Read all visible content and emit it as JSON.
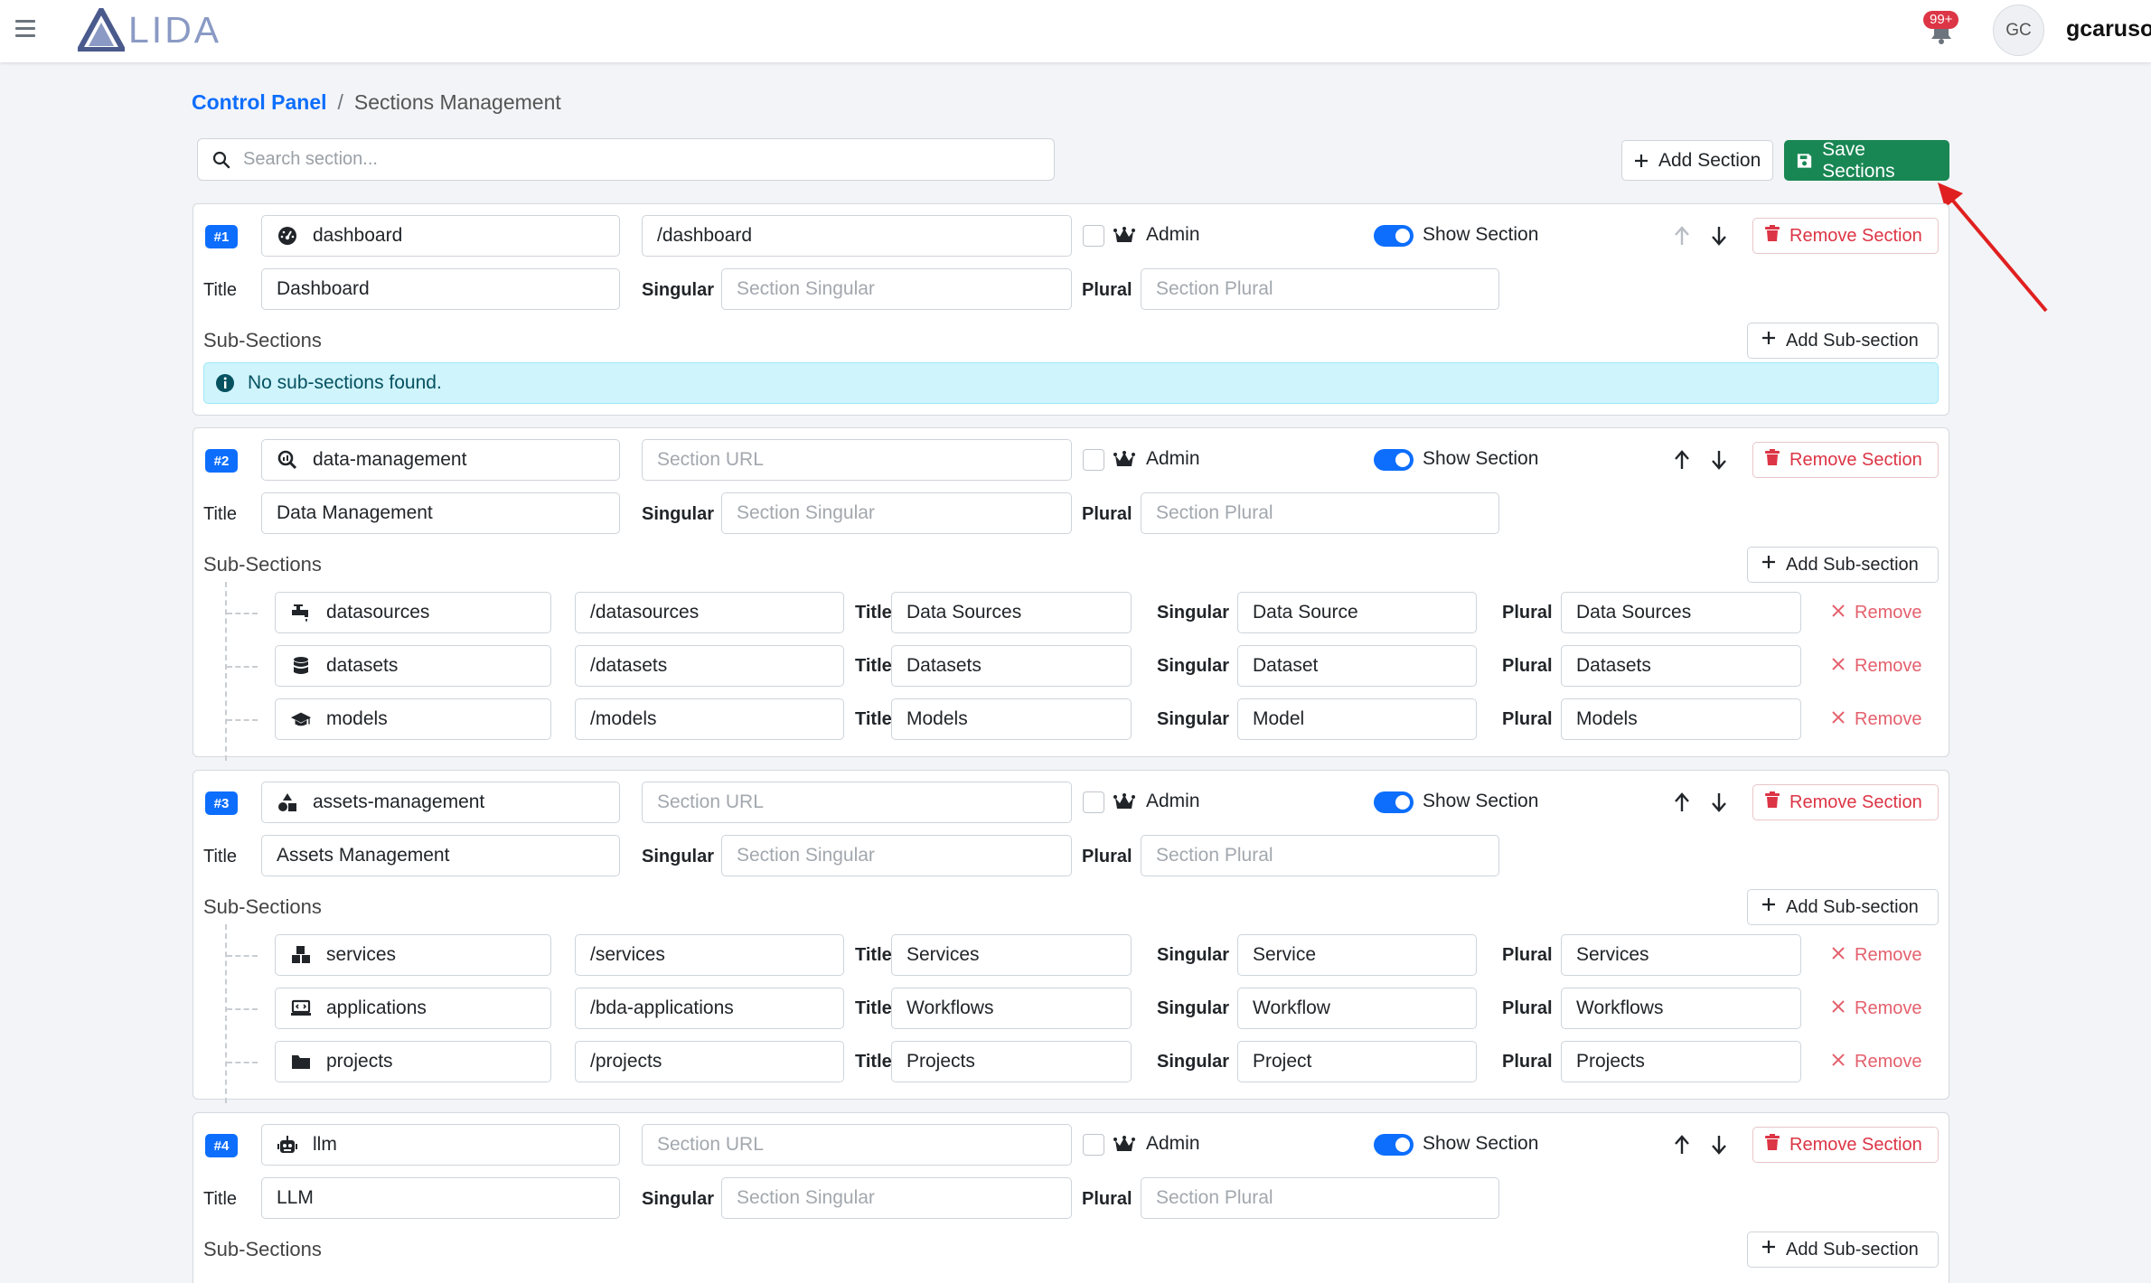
{
  "app": {
    "logo_text": "LIDA",
    "notification_count": "99+",
    "user_initials": "GC",
    "username": "gcaruso"
  },
  "breadcrumb": {
    "root": "Control Panel",
    "separator": "/",
    "current": "Sections Management"
  },
  "toolbar": {
    "search_placeholder": "Search section...",
    "add_section_label": "Add Section",
    "save_sections_label": "Save Sections"
  },
  "labels": {
    "admin": "Admin",
    "show_section": "Show Section",
    "remove_section": "Remove Section",
    "title": "Title",
    "singular": "Singular",
    "plural": "Plural",
    "sub_sections": "Sub-Sections",
    "add_sub_section": "Add Sub-section",
    "remove": "Remove",
    "no_sub_sections": "No sub-sections found.",
    "section_url_placeholder": "Section URL",
    "section_singular_placeholder": "Section Singular",
    "section_plural_placeholder": "Section Plural"
  },
  "sections": [
    {
      "badge": "#1",
      "icon": "dashboard-gauge-icon",
      "name": "dashboard",
      "url": "/dashboard",
      "title": "Dashboard",
      "singular": "",
      "plural": "",
      "admin": false,
      "show": true,
      "up_enabled": false,
      "subsections": []
    },
    {
      "badge": "#2",
      "icon": "magnifier-chart-icon",
      "name": "data-management",
      "url": "",
      "title": "Data Management",
      "singular": "",
      "plural": "",
      "admin": false,
      "show": true,
      "up_enabled": true,
      "subsections": [
        {
          "icon": "faucet-icon",
          "name": "datasources",
          "url": "/datasources",
          "title": "Data Sources",
          "singular": "Data Source",
          "plural": "Data Sources"
        },
        {
          "icon": "database-icon",
          "name": "datasets",
          "url": "/datasets",
          "title": "Datasets",
          "singular": "Dataset",
          "plural": "Datasets"
        },
        {
          "icon": "graduation-cap-icon",
          "name": "models",
          "url": "/models",
          "title": "Models",
          "singular": "Model",
          "plural": "Models"
        }
      ]
    },
    {
      "badge": "#3",
      "icon": "shapes-icon",
      "name": "assets-management",
      "url": "",
      "title": "Assets Management",
      "singular": "",
      "plural": "",
      "admin": false,
      "show": true,
      "up_enabled": true,
      "subsections": [
        {
          "icon": "cubes-icon",
          "name": "services",
          "url": "/services",
          "title": "Services",
          "singular": "Service",
          "plural": "Services"
        },
        {
          "icon": "laptop-code-icon",
          "name": "applications",
          "url": "/bda-applications",
          "title": "Workflows",
          "singular": "Workflow",
          "plural": "Workflows"
        },
        {
          "icon": "folder-icon",
          "name": "projects",
          "url": "/projects",
          "title": "Projects",
          "singular": "Project",
          "plural": "Projects"
        }
      ]
    },
    {
      "badge": "#4",
      "icon": "robot-icon",
      "name": "llm",
      "url": "",
      "title": "LLM",
      "singular": "",
      "plural": "",
      "admin": false,
      "show": true,
      "up_enabled": true,
      "subsections": []
    }
  ],
  "colors": {
    "primary": "#0d6efd",
    "success": "#198754",
    "danger": "#dc3545",
    "info_bg": "#cff4fc",
    "annotation_arrow": "#e02020"
  }
}
